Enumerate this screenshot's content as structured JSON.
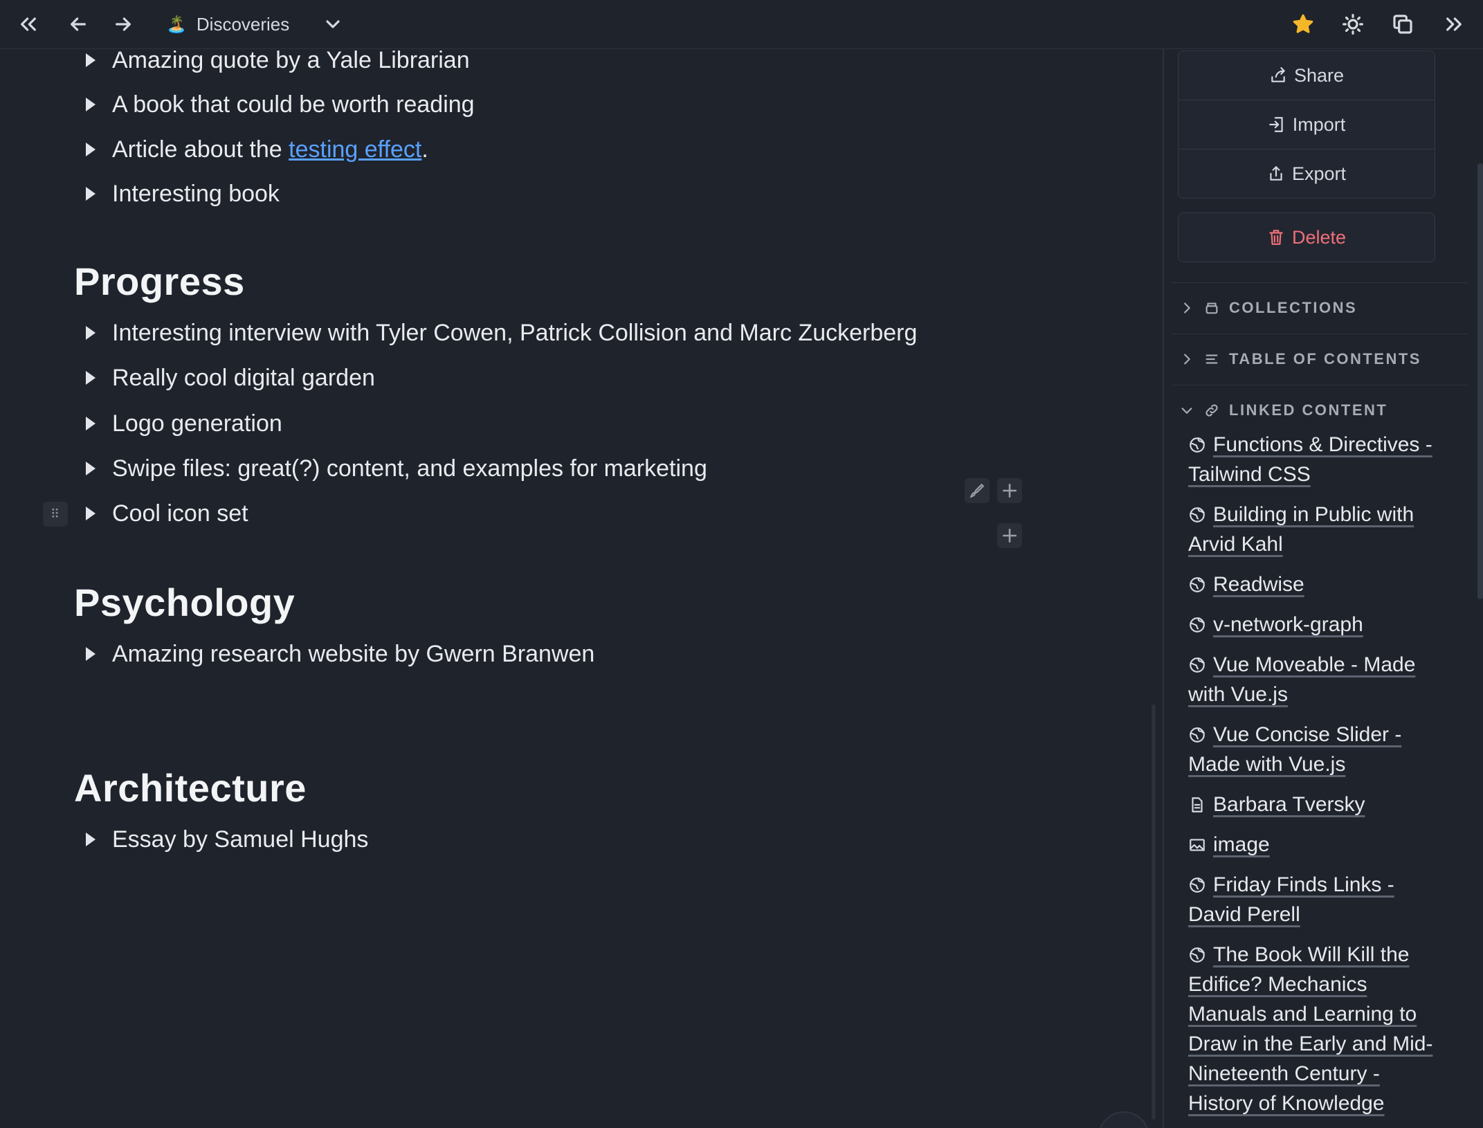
{
  "topbar": {
    "page_emoji": "🏝️",
    "page_title": "Discoveries"
  },
  "main": {
    "items_top": [
      {
        "text": "Amazing quote by a Yale Librarian"
      },
      {
        "text": "A book that could be worth reading"
      },
      {
        "prefix": "Article about the ",
        "link": "testing effect",
        "suffix": "."
      },
      {
        "text": "Interesting book"
      }
    ],
    "sections": [
      {
        "heading": "Progress",
        "items": [
          "Interesting interview with Tyler Cowen, Patrick Collision and Marc Zuckerberg",
          "Really cool digital garden",
          "Logo generation",
          "Swipe files: great(?) content, and examples for marketing",
          "Cool icon set"
        ]
      },
      {
        "heading": "Psychology",
        "items": [
          "Amazing research website by Gwern Branwen"
        ]
      },
      {
        "heading": "Architecture",
        "items": [
          "Essay by Samuel Hughs"
        ]
      }
    ],
    "help_label": "?"
  },
  "sidebar": {
    "actions": {
      "share": "Share",
      "import": "Import",
      "export": "Export",
      "delete": "Delete"
    },
    "collections": "COLLECTIONS",
    "toc": "TABLE OF CONTENTS",
    "linked_content": "LINKED CONTENT",
    "linked_items": [
      {
        "icon": "globe-icon",
        "label": "Functions & Directives - Tailwind CSS"
      },
      {
        "icon": "globe-icon",
        "label": "Building in Public with Arvid Kahl"
      },
      {
        "icon": "globe-icon",
        "label": "Readwise"
      },
      {
        "icon": "globe-icon",
        "label": "v-network-graph"
      },
      {
        "icon": "globe-icon",
        "label": "Vue Moveable - Made with Vue.js"
      },
      {
        "icon": "globe-icon",
        "label": "Vue Concise Slider - Made with Vue.js"
      },
      {
        "icon": "document-icon",
        "label": "Barbara Tversky"
      },
      {
        "icon": "image-icon",
        "label": "image"
      },
      {
        "icon": "globe-icon",
        "label": "Friday Finds Links - David Perell"
      },
      {
        "icon": "globe-icon",
        "label": "The Book Will Kill the Edifice? Mechanics Manuals and Learning to Draw in the Early and Mid-Nineteenth Century - History of Knowledge"
      }
    ]
  },
  "colors": {
    "background": "#1f232b",
    "link": "#5aa1ff",
    "star": "#f5b72a",
    "delete": "#f0707a"
  }
}
